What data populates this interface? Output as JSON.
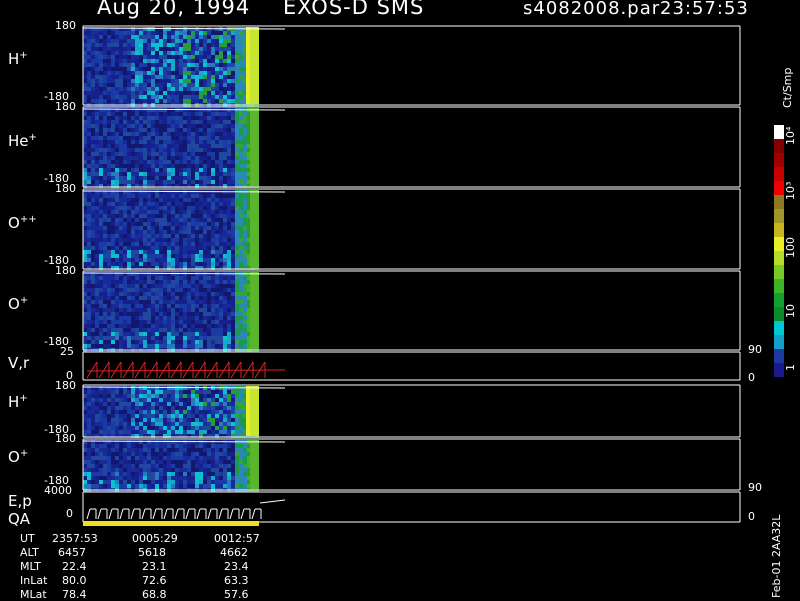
{
  "header": {
    "date": "Aug 20, 1994",
    "instrument": "EXOS-D SMS",
    "file": "s4082008.par",
    "time": "23:57:53"
  },
  "chart_data": {
    "type": "heatmap",
    "description_axis_x": "UT time",
    "panels": [
      {
        "name": "H",
        "charge": "+",
        "ymax": "180",
        "ymin": "-180"
      },
      {
        "name": "He",
        "charge": "+",
        "ymax": "180",
        "ymin": "-180"
      },
      {
        "name": "O",
        "charge": "++",
        "ymax": "180",
        "ymin": "-180"
      },
      {
        "name": "O",
        "charge": "+",
        "ymax": "180",
        "ymin": "-180"
      },
      {
        "name": "V,r",
        "charge": "",
        "ymax": "25",
        "ymin": "0",
        "right_max": "90",
        "right_min": "0"
      },
      {
        "name": "H",
        "charge": "+",
        "ymax": "180",
        "ymin": "-180"
      },
      {
        "name": "O",
        "charge": "+",
        "ymax": "180",
        "ymin": "-180"
      },
      {
        "name": "E,p",
        "charge": "",
        "ymax": "4000",
        "ymin": "0",
        "right_max": "90",
        "right_min": "0"
      }
    ],
    "qa_label": "QA",
    "colorbar": {
      "unit": "Ct/Smp",
      "ticks": [
        "1",
        "10",
        "100",
        "10³",
        "10⁴"
      ],
      "colors": [
        "#1a1a90",
        "#1e3aa0",
        "#12a0c8",
        "#00c8d0",
        "#0a8a2a",
        "#14a030",
        "#3cb428",
        "#78c828",
        "#b4dc28",
        "#e6f028",
        "#c8b41e",
        "#a09628",
        "#8c7820",
        "#f00000",
        "#c80000",
        "#a00000",
        "#800000",
        "#ffffff"
      ]
    }
  },
  "ephemeris": {
    "labels": [
      "UT",
      "ALT",
      "MLT",
      "InLat",
      "MLat"
    ],
    "columns": [
      [
        "2357:53",
        "6457",
        "22.4",
        "80.0",
        "78.4"
      ],
      [
        "0005:29",
        "5618",
        "23.1",
        "72.6",
        "68.8"
      ],
      [
        "0012:57",
        "4662",
        "23.4",
        "63.3",
        "57.6"
      ]
    ]
  },
  "footer_id": "Feb-01 2AA32L"
}
